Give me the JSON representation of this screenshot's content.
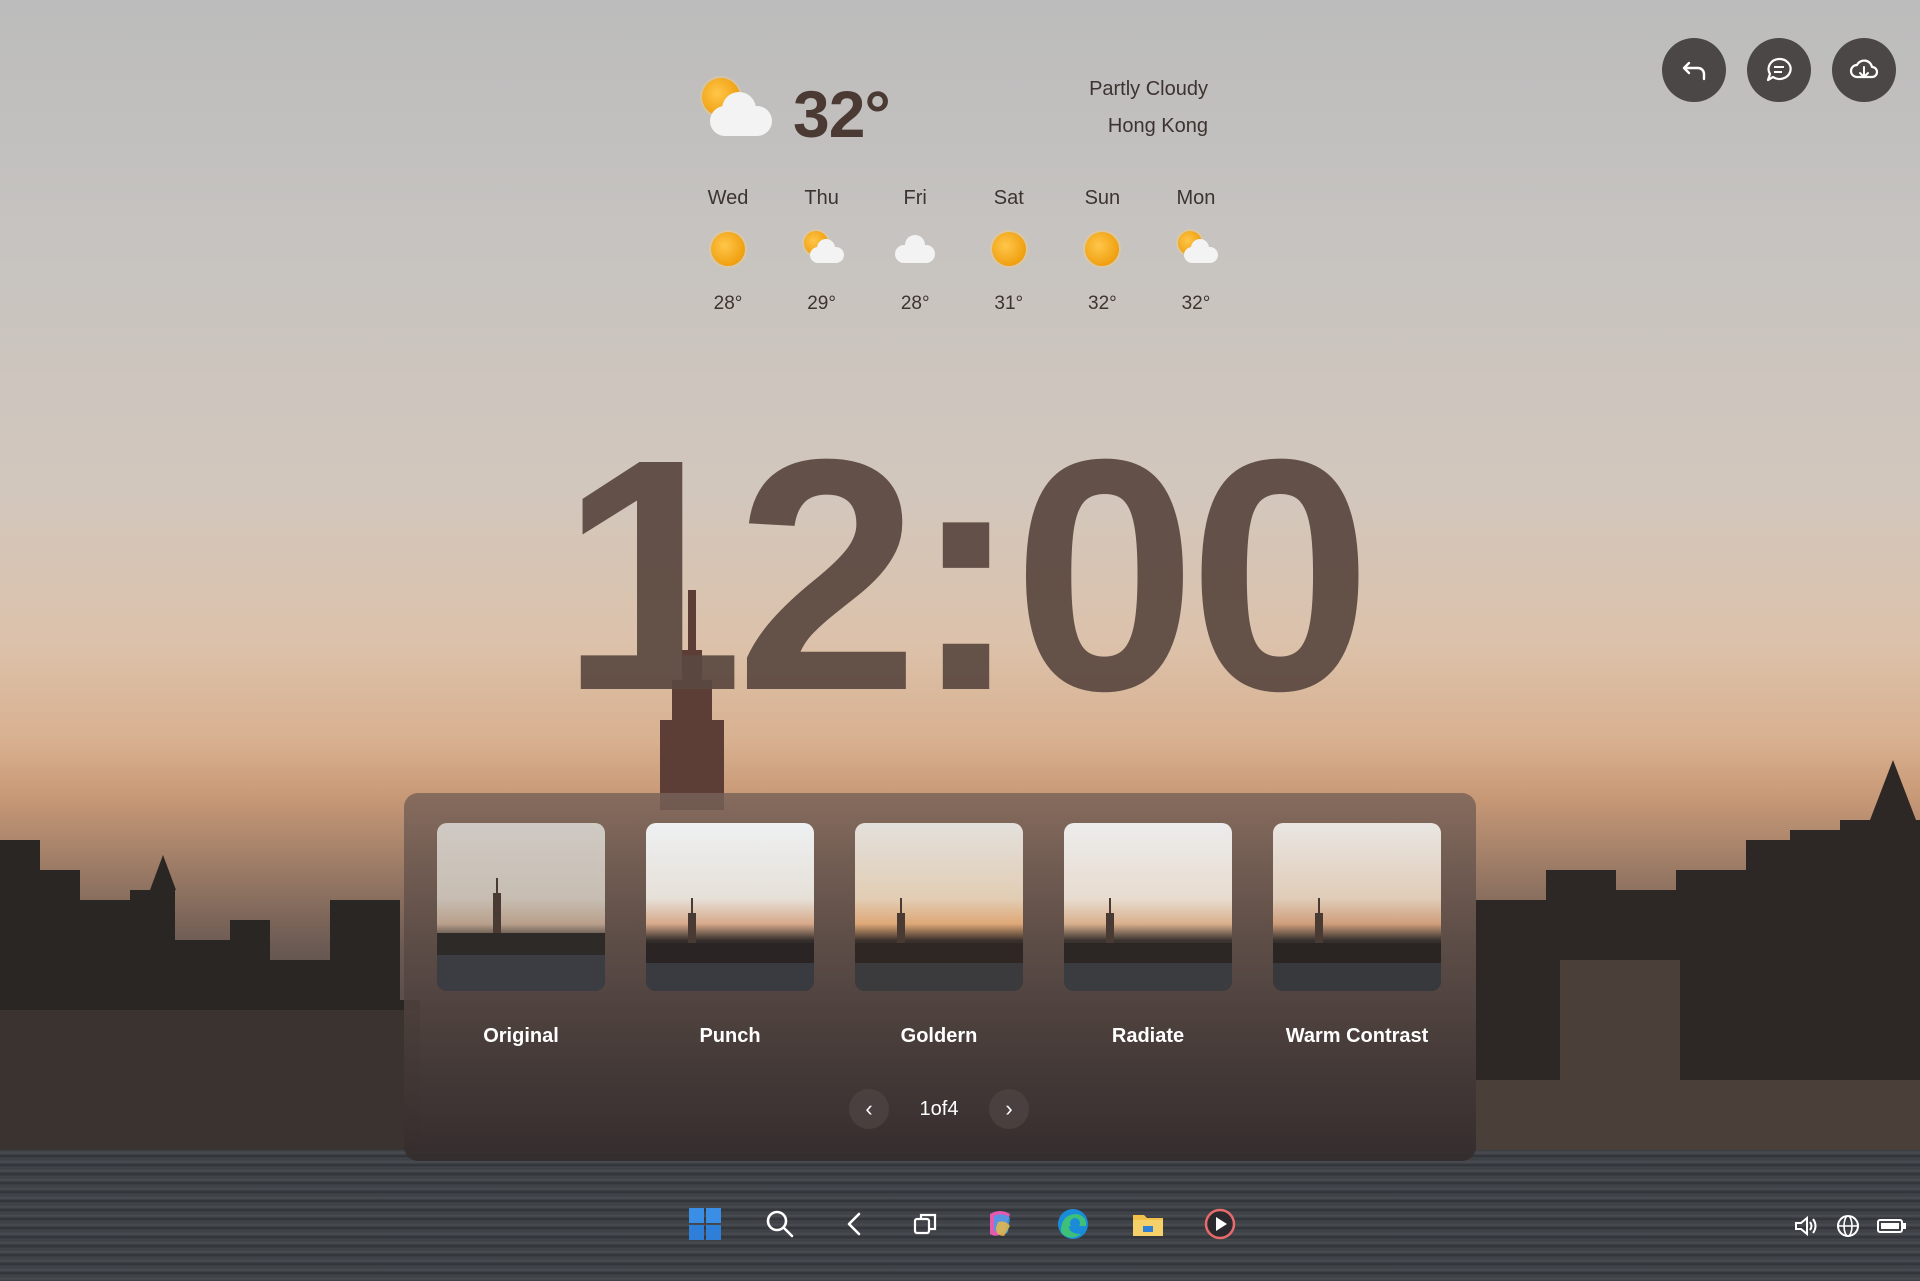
{
  "weather": {
    "current_temp": "32°",
    "condition": "Partly Cloudy",
    "location": "Hong Kong",
    "current_icon": "partly-cloudy-icon",
    "forecast": [
      {
        "day": "Wed",
        "temp": "28°",
        "icon": "sunny-icon"
      },
      {
        "day": "Thu",
        "temp": "29°",
        "icon": "partly-cloudy-icon"
      },
      {
        "day": "Fri",
        "temp": "28°",
        "icon": "cloudy-icon"
      },
      {
        "day": "Sat",
        "temp": "31°",
        "icon": "sunny-icon"
      },
      {
        "day": "Sun",
        "temp": "32°",
        "icon": "sunny-icon"
      },
      {
        "day": "Mon",
        "temp": "32°",
        "icon": "partly-cloudy-icon"
      }
    ]
  },
  "clock": {
    "time": "12:00"
  },
  "top_controls": [
    {
      "name": "undo-button",
      "icon": "undo-arrow-icon"
    },
    {
      "name": "chat-button",
      "icon": "chat-bubble-icon"
    },
    {
      "name": "cloud-sync-button",
      "icon": "cloud-sync-icon"
    }
  ],
  "style_picker": {
    "styles": [
      {
        "label": "Original"
      },
      {
        "label": "Punch"
      },
      {
        "label": "Goldern"
      },
      {
        "label": "Radiate"
      },
      {
        "label": "Warm Contrast"
      }
    ],
    "page_indicator": "1of4",
    "prev_icon": "chevron-left-icon",
    "next_icon": "chevron-right-icon"
  },
  "taskbar": {
    "icons": [
      "start-icon",
      "search-icon",
      "back-icon",
      "task-view-icon",
      "copilot-icon",
      "edge-icon",
      "file-explorer-icon",
      "media-player-icon"
    ]
  },
  "system_tray": {
    "icons": [
      "volume-icon",
      "network-icon",
      "battery-icon"
    ]
  },
  "colors": {
    "clock": "#5a4840",
    "sun": "#f0a010",
    "panel": "#4a3e3c"
  }
}
